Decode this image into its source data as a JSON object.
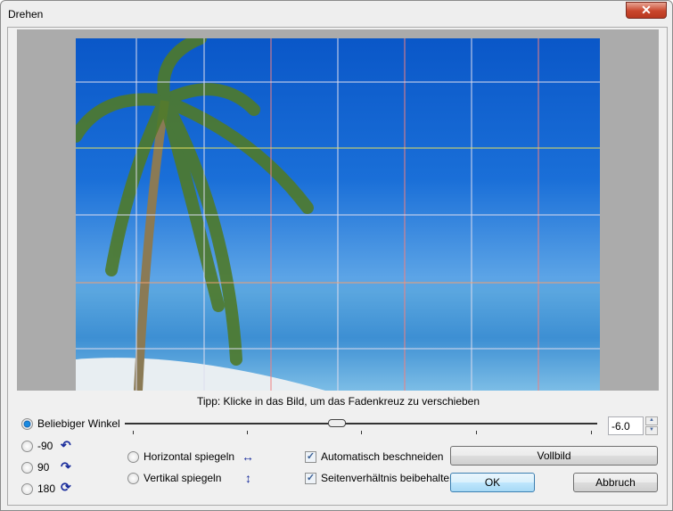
{
  "window": {
    "title": "Drehen",
    "close_label": "✕"
  },
  "tip": "Tipp: Klicke in das Bild, um das Fadenkreuz zu verschieben",
  "angle": {
    "label": "Beliebiger Winkel",
    "value": "-6.0",
    "slider_min": -45,
    "slider_max": 45,
    "slider_value": -6.0
  },
  "rotations": [
    {
      "label": "-90",
      "icon": "rotate-left-icon"
    },
    {
      "label": "90",
      "icon": "rotate-right-icon"
    },
    {
      "label": "180",
      "icon": "rotate-180-icon"
    }
  ],
  "flips": [
    {
      "label": "Horizontal spiegeln",
      "icon": "↔"
    },
    {
      "label": "Vertikal spiegeln",
      "icon": "↕"
    }
  ],
  "options": [
    {
      "label": "Automatisch beschneiden",
      "checked": true
    },
    {
      "label": "Seitenverhältnis beibehalten",
      "checked": true
    }
  ],
  "buttons": {
    "fullscreen": "Vollbild",
    "ok": "OK",
    "cancel": "Abbruch"
  },
  "colors": {
    "accent": "#3c7fb1"
  }
}
